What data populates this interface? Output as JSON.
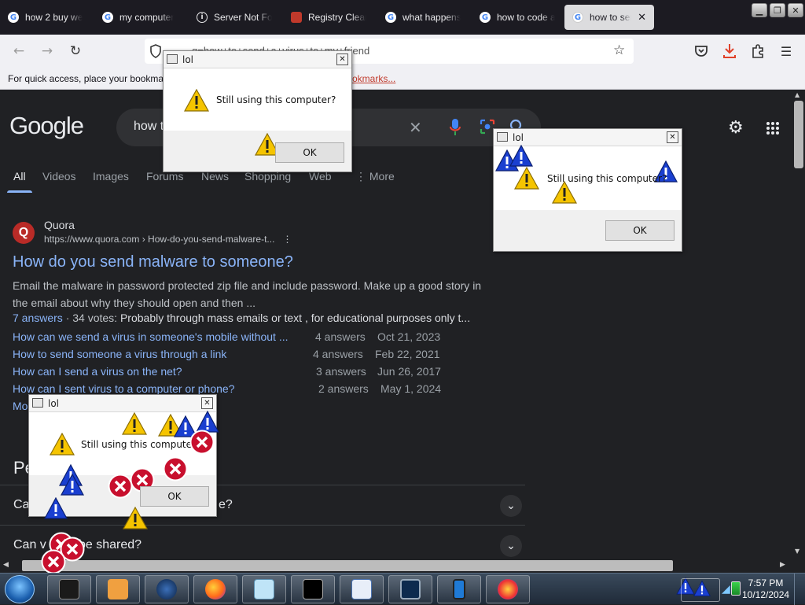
{
  "browser": {
    "tabs": [
      {
        "label": "how 2 buy we",
        "favicon": "google-icon"
      },
      {
        "label": "my computer",
        "favicon": "google-icon"
      },
      {
        "label": "Server Not Fo",
        "favicon": "info-icon"
      },
      {
        "label": "Registry Clear",
        "favicon": "site-icon"
      },
      {
        "label": "what happens",
        "favicon": "google-icon"
      },
      {
        "label": "how to code a",
        "favicon": "google-icon"
      },
      {
        "label": "how to send",
        "favicon": "google-icon",
        "active": true,
        "close": "✕"
      }
    ],
    "url": "q=how+to+send+a+virus+to+my+friend",
    "bookmarks_message": "For quick access, place your bookmar",
    "bookmarks_link": "okmarks..."
  },
  "google": {
    "logo": "Google",
    "query": "how t",
    "tabs": [
      "All",
      "Videos",
      "Images",
      "Forums",
      "News",
      "Shopping",
      "Web",
      "More"
    ],
    "result": {
      "icon_letter": "Q",
      "site": "Quora",
      "url": "https://www.quora.com › How-do-you-send-malware-t...",
      "url_menu": "⋮",
      "title": "How do you send malware to someone?",
      "snippet": "Email the malware in password protected zip file and include password. Make up a good story in the email about why they should open and then ...",
      "answers_link": "7 answers",
      "votes": " · 34 votes: ",
      "top_answer": "Probably through mass emails or text , for educational purposes only t...",
      "related": [
        {
          "question": "How can we send a virus in someone's mobile without ...",
          "answers": "4 answers",
          "date": "Oct 21, 2023"
        },
        {
          "question": "How to send someone a virus through a link",
          "answers": "4 answers",
          "date": "Feb 22, 2021"
        },
        {
          "question": "How can I send a virus on the net?",
          "answers": "3 answers",
          "date": "Jun 26, 2017"
        },
        {
          "question": "How can I sent virus to a computer or phone?",
          "answers": "2 answers",
          "date": "May 1, 2024"
        }
      ],
      "more_link": "Mo"
    },
    "people_also_ask": {
      "heading": "Pe",
      "items": [
        {
          "text": "Ca",
          "tail": "e?"
        },
        {
          "text": "Can v",
          "tail": "be shared?"
        }
      ]
    }
  },
  "dialogs": [
    {
      "title": "lol",
      "message": "Still using this computer?",
      "ok": "OK"
    },
    {
      "title": "lol",
      "message": "Still using this computer?",
      "ok": "OK"
    },
    {
      "title": "lol",
      "message": "Still using this computer?",
      "ok": "OK"
    }
  ],
  "taskbar": {
    "time": "7:57 PM",
    "date": "10/12/2024"
  },
  "colors": {
    "link": "#8ab4f8",
    "page_bg": "#202124",
    "warning": "#f5c400",
    "info": "#1a3fd0",
    "error": "#c8102e"
  }
}
